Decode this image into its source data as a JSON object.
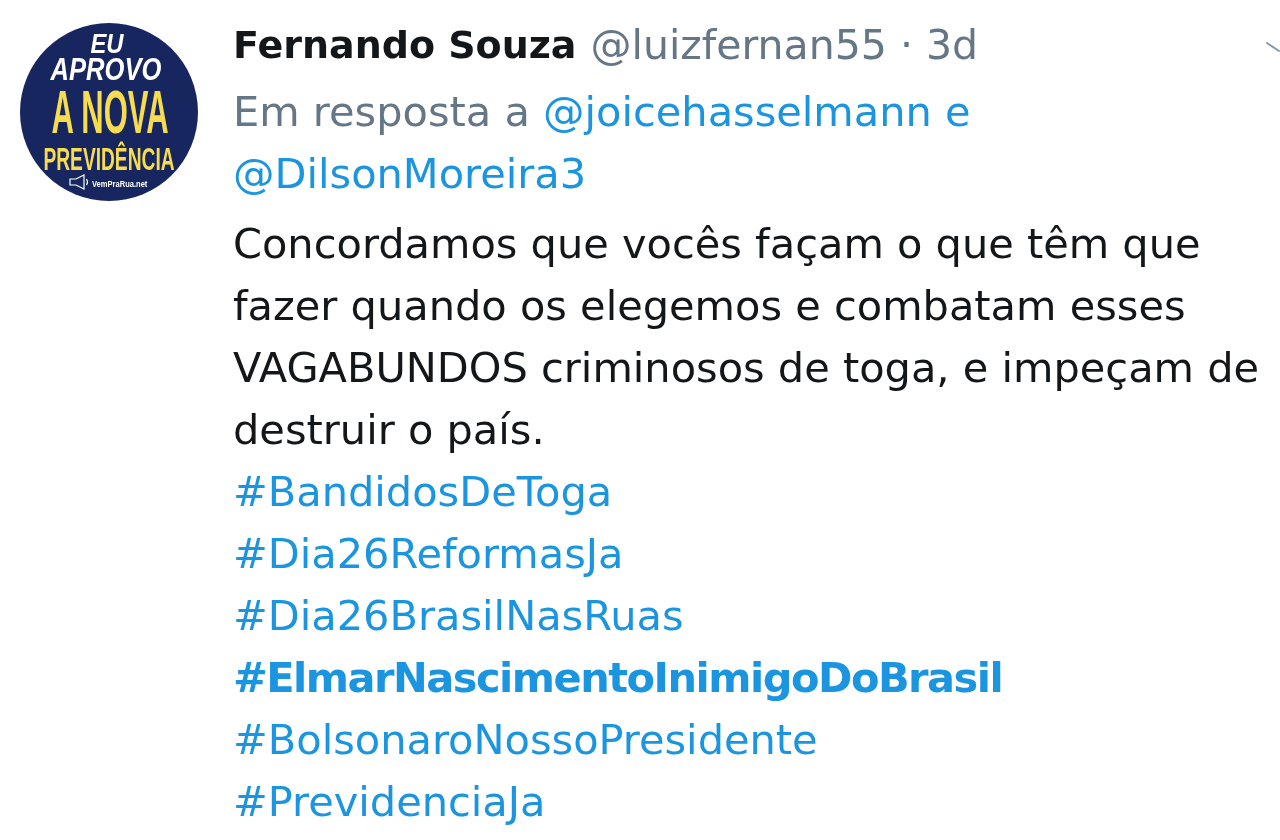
{
  "avatar": {
    "lines": [
      {
        "kind": "script",
        "text": "EU"
      },
      {
        "kind": "script",
        "text": "APROVO"
      },
      {
        "kind": "headline",
        "text": "A NOVA"
      },
      {
        "kind": "subhead",
        "text": "PREVIDÊNCIA"
      }
    ],
    "footer": "VemPraRua.net"
  },
  "tweet": {
    "author": "Fernando Souza",
    "handle": "@luizfernan55",
    "separator": "·",
    "time": "3d",
    "reply": {
      "prefix": "Em resposta a",
      "mentions": [
        "@joicehasselmann",
        "@DilsonMoreira3"
      ],
      "joiner": "e"
    },
    "text": "Concordamos que vocês façam o que têm que fazer quando os elegemos e combatam esses VAGABUNDOS criminosos de toga, e impeçam de destruir o país.",
    "hashtags": [
      {
        "text": "#BandidosDeToga",
        "bold": false
      },
      {
        "text": "#Dia26ReformasJa",
        "bold": false
      },
      {
        "text": "#Dia26BrasilNasRuas",
        "bold": false
      },
      {
        "text": "#ElmarNascimentoInimigoDoBrasil",
        "bold": true
      },
      {
        "text": "#BolsonaroNossoPresidente",
        "bold": false
      },
      {
        "text": "#PrevidenciaJa",
        "bold": false
      }
    ]
  }
}
